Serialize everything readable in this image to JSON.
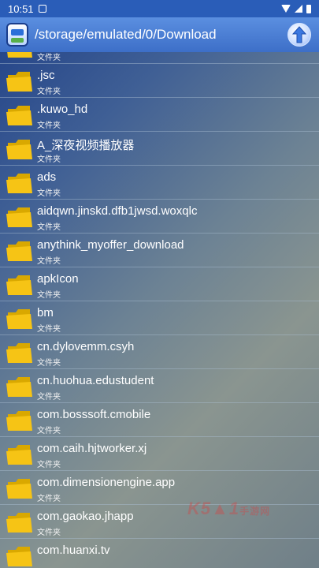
{
  "status_bar": {
    "time": "10:51"
  },
  "toolbar": {
    "path": "/storage/emulated/0/Download"
  },
  "list": {
    "partial_top_sub": "文件夹",
    "items": [
      {
        "name": ".jsc",
        "type": "文件夹"
      },
      {
        "name": ".kuwo_hd",
        "type": "文件夹"
      },
      {
        "name": "A_深夜视频播放器",
        "type": "文件夹"
      },
      {
        "name": "ads",
        "type": "文件夹"
      },
      {
        "name": "aidqwn.jinskd.dfb1jwsd.woxqlc",
        "type": "文件夹"
      },
      {
        "name": "anythink_myoffer_download",
        "type": "文件夹"
      },
      {
        "name": "apkIcon",
        "type": "文件夹"
      },
      {
        "name": "bm",
        "type": "文件夹"
      },
      {
        "name": "cn.dylovemm.csyh",
        "type": "文件夹"
      },
      {
        "name": "cn.huohua.edustudent",
        "type": "文件夹"
      },
      {
        "name": "com.bosssoft.cmobile",
        "type": "文件夹"
      },
      {
        "name": "com.caih.hjtworker.xj",
        "type": "文件夹"
      },
      {
        "name": "com.dimensionengine.app",
        "type": "文件夹"
      },
      {
        "name": "com.gaokao.jhapp",
        "type": "文件夹"
      },
      {
        "name": "com.huanxi.tv",
        "type": ""
      }
    ]
  },
  "watermark": {
    "text": "K5▲1",
    "suffix": "手游网"
  },
  "icons": {
    "folder": "folder-icon",
    "up": "up-arrow-icon",
    "app": "app-icon",
    "wifi": "wifi-icon",
    "signal": "signal-icon",
    "battery": "battery-icon",
    "notification": "notification-icon"
  },
  "colors": {
    "status_bar": "#2a5db8",
    "toolbar": "#4a7fd6",
    "folder": "#f6c415"
  }
}
